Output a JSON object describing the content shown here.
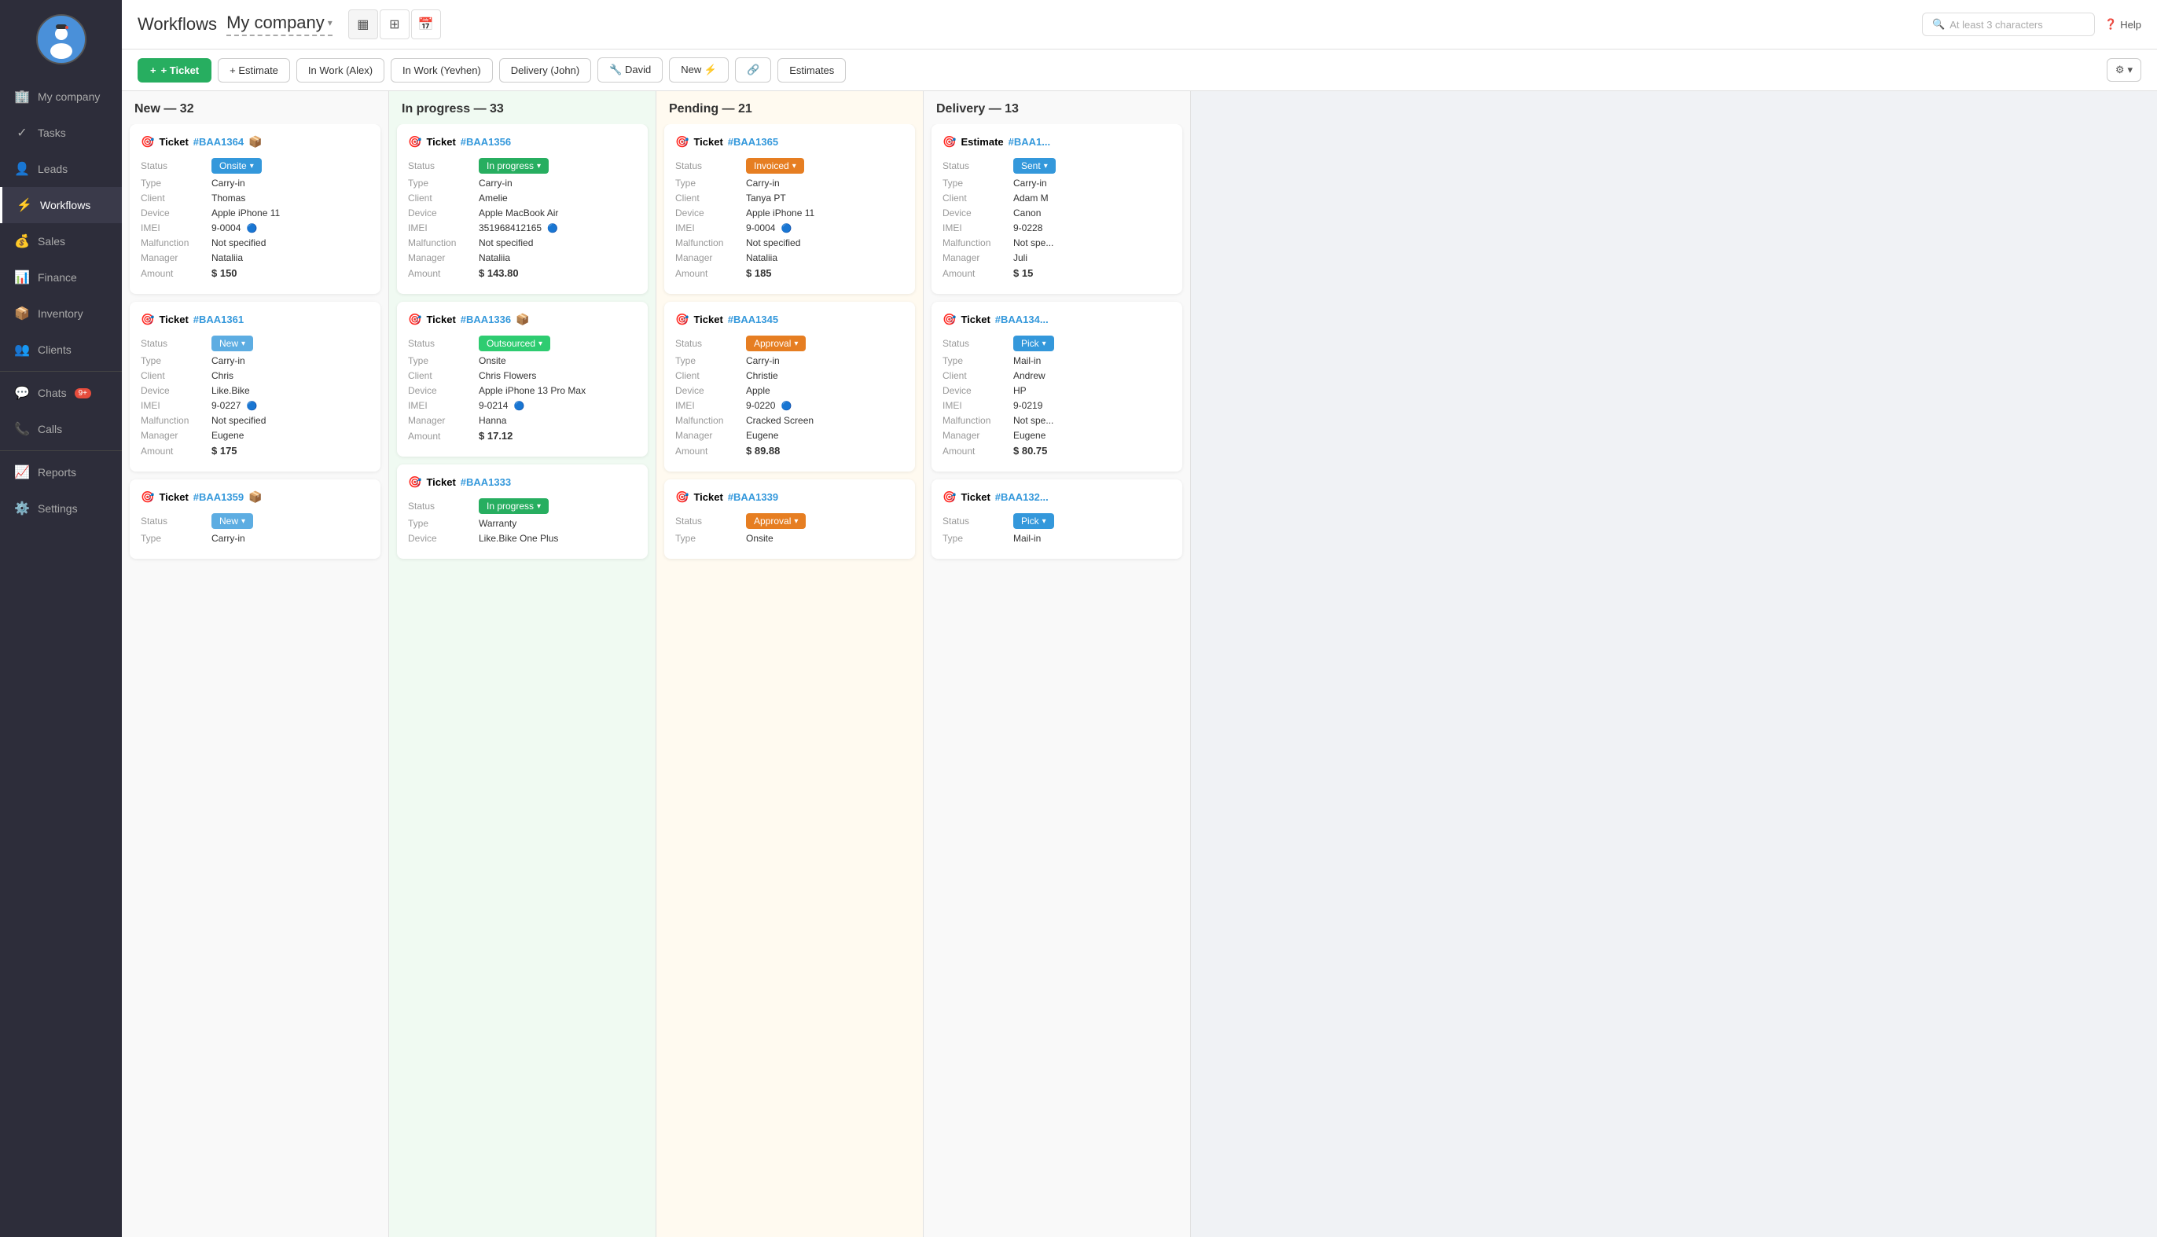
{
  "sidebar": {
    "items": [
      {
        "id": "my-company",
        "label": "My company",
        "icon": "🏢"
      },
      {
        "id": "tasks",
        "label": "Tasks",
        "icon": "✓"
      },
      {
        "id": "leads",
        "label": "Leads",
        "icon": "👤"
      },
      {
        "id": "workflows",
        "label": "Workflows",
        "icon": "⚡",
        "active": true
      },
      {
        "id": "sales",
        "label": "Sales",
        "icon": "💰"
      },
      {
        "id": "finance",
        "label": "Finance",
        "icon": "📊"
      },
      {
        "id": "inventory",
        "label": "Inventory",
        "icon": "📦"
      },
      {
        "id": "clients",
        "label": "Clients",
        "icon": "👥"
      },
      {
        "id": "chats",
        "label": "Chats",
        "icon": "💬",
        "badge": "9+"
      },
      {
        "id": "calls",
        "label": "Calls",
        "icon": "📞"
      },
      {
        "id": "reports",
        "label": "Reports",
        "icon": "📈"
      },
      {
        "id": "settings",
        "label": "Settings",
        "icon": "⚙️"
      }
    ]
  },
  "header": {
    "title": "Workflows",
    "company": "My company",
    "search_placeholder": "At least 3 characters",
    "help_label": "Help"
  },
  "toolbar": {
    "add_ticket": "+ Ticket",
    "add_estimate": "+ Estimate",
    "filters": [
      "In Work (Alex)",
      "In Work (Yevhen)",
      "Delivery (John)",
      "🔧 David",
      "New ⚡",
      "🔗",
      "Estimates"
    ],
    "settings_icon": "⚙"
  },
  "columns": [
    {
      "id": "new",
      "title": "New",
      "count": 32,
      "color": "new",
      "cards": [
        {
          "type": "Ticket",
          "number": "#BAA1364",
          "has_icon": true,
          "status": "Onsite",
          "status_class": "status-onsite",
          "ticket_type": "Carry-in",
          "client": "Thomas",
          "device": "Apple iPhone 11",
          "imei": "9-0004",
          "malfunction": "Not specified",
          "manager": "Nataliia",
          "amount": "$ 150"
        },
        {
          "type": "Ticket",
          "number": "#BAA1361",
          "has_icon": false,
          "status": "New",
          "status_class": "status-new",
          "ticket_type": "Carry-in",
          "client": "Chris",
          "device": "Like.Bike",
          "imei": "9-0227",
          "malfunction": "Not specified",
          "manager": "Eugene",
          "amount": "$ 175"
        },
        {
          "type": "Ticket",
          "number": "#BAA1359",
          "has_icon": true,
          "status": "New",
          "status_class": "status-new",
          "ticket_type": "Carry-in",
          "client": "",
          "device": "",
          "imei": "",
          "malfunction": "",
          "manager": "",
          "amount": ""
        }
      ]
    },
    {
      "id": "inprogress",
      "title": "In progress",
      "count": 33,
      "color": "inprogress",
      "cards": [
        {
          "type": "Ticket",
          "number": "#BAA1356",
          "has_icon": false,
          "status": "In progress",
          "status_class": "status-inprogress",
          "ticket_type": "Carry-in",
          "client": "Amelie",
          "device": "Apple MacBook Air",
          "imei": "351968412165",
          "malfunction": "Not specified",
          "manager": "Nataliia",
          "amount": "$ 143.80"
        },
        {
          "type": "Ticket",
          "number": "#BAA1336",
          "has_icon": true,
          "status": "Outsourced",
          "status_class": "status-outsourced",
          "ticket_type": "Onsite",
          "client": "Chris Flowers",
          "device": "Apple iPhone 13 Pro Max",
          "imei": "9-0214",
          "malfunction": "",
          "manager": "Hanna",
          "amount": "$ 17.12"
        },
        {
          "type": "Ticket",
          "number": "#BAA1333",
          "has_icon": false,
          "status": "In progress",
          "status_class": "status-inprogress",
          "ticket_type": "Warranty",
          "client": "",
          "device": "Like.Bike One Plus",
          "imei": "",
          "malfunction": "",
          "manager": "",
          "amount": ""
        }
      ]
    },
    {
      "id": "pending",
      "title": "Pending",
      "count": 21,
      "color": "pending",
      "cards": [
        {
          "type": "Ticket",
          "number": "#BAA1365",
          "has_icon": false,
          "status": "Invoiced",
          "status_class": "status-invoiced",
          "ticket_type": "Carry-in",
          "client": "Tanya PT",
          "device": "Apple iPhone 11",
          "imei": "9-0004",
          "malfunction": "Not specified",
          "manager": "Nataliia",
          "amount": "$ 185"
        },
        {
          "type": "Ticket",
          "number": "#BAA1345",
          "has_icon": false,
          "status": "Approval",
          "status_class": "status-approval",
          "ticket_type": "Carry-in",
          "client": "Christie",
          "device": "Apple",
          "imei": "9-0220",
          "malfunction": "Cracked Screen",
          "manager": "Eugene",
          "amount": "$ 89.88"
        },
        {
          "type": "Ticket",
          "number": "#BAA1339",
          "has_icon": false,
          "status": "Approval",
          "status_class": "status-approval",
          "ticket_type": "Onsite",
          "client": "",
          "device": "",
          "imei": "",
          "malfunction": "",
          "manager": "",
          "amount": ""
        }
      ]
    },
    {
      "id": "delivery",
      "title": "Delivery",
      "count": 13,
      "color": "delivery",
      "cards": [
        {
          "type": "Estimate",
          "number": "#BAA1",
          "has_icon": false,
          "status": "Sent",
          "status_class": "status-sent",
          "ticket_type": "Carry-in",
          "client": "Adam M",
          "device": "Canon",
          "imei": "9-0228",
          "malfunction": "Not spe",
          "manager": "Juli",
          "amount": "$ 15"
        },
        {
          "type": "Ticket",
          "number": "#BAA134",
          "has_icon": false,
          "status": "Pick",
          "status_class": "status-pick",
          "ticket_type": "Mail-in",
          "client": "Andrew",
          "device": "HP",
          "imei": "9-0219",
          "malfunction": "Not spe",
          "manager": "Eugene",
          "amount": "$ 80.75"
        },
        {
          "type": "Ticket",
          "number": "#BAA132",
          "has_icon": false,
          "status": "Pick",
          "status_class": "status-pick",
          "ticket_type": "Mail-in",
          "client": "",
          "device": "",
          "imei": "",
          "malfunction": "",
          "manager": "",
          "amount": ""
        }
      ]
    }
  ]
}
